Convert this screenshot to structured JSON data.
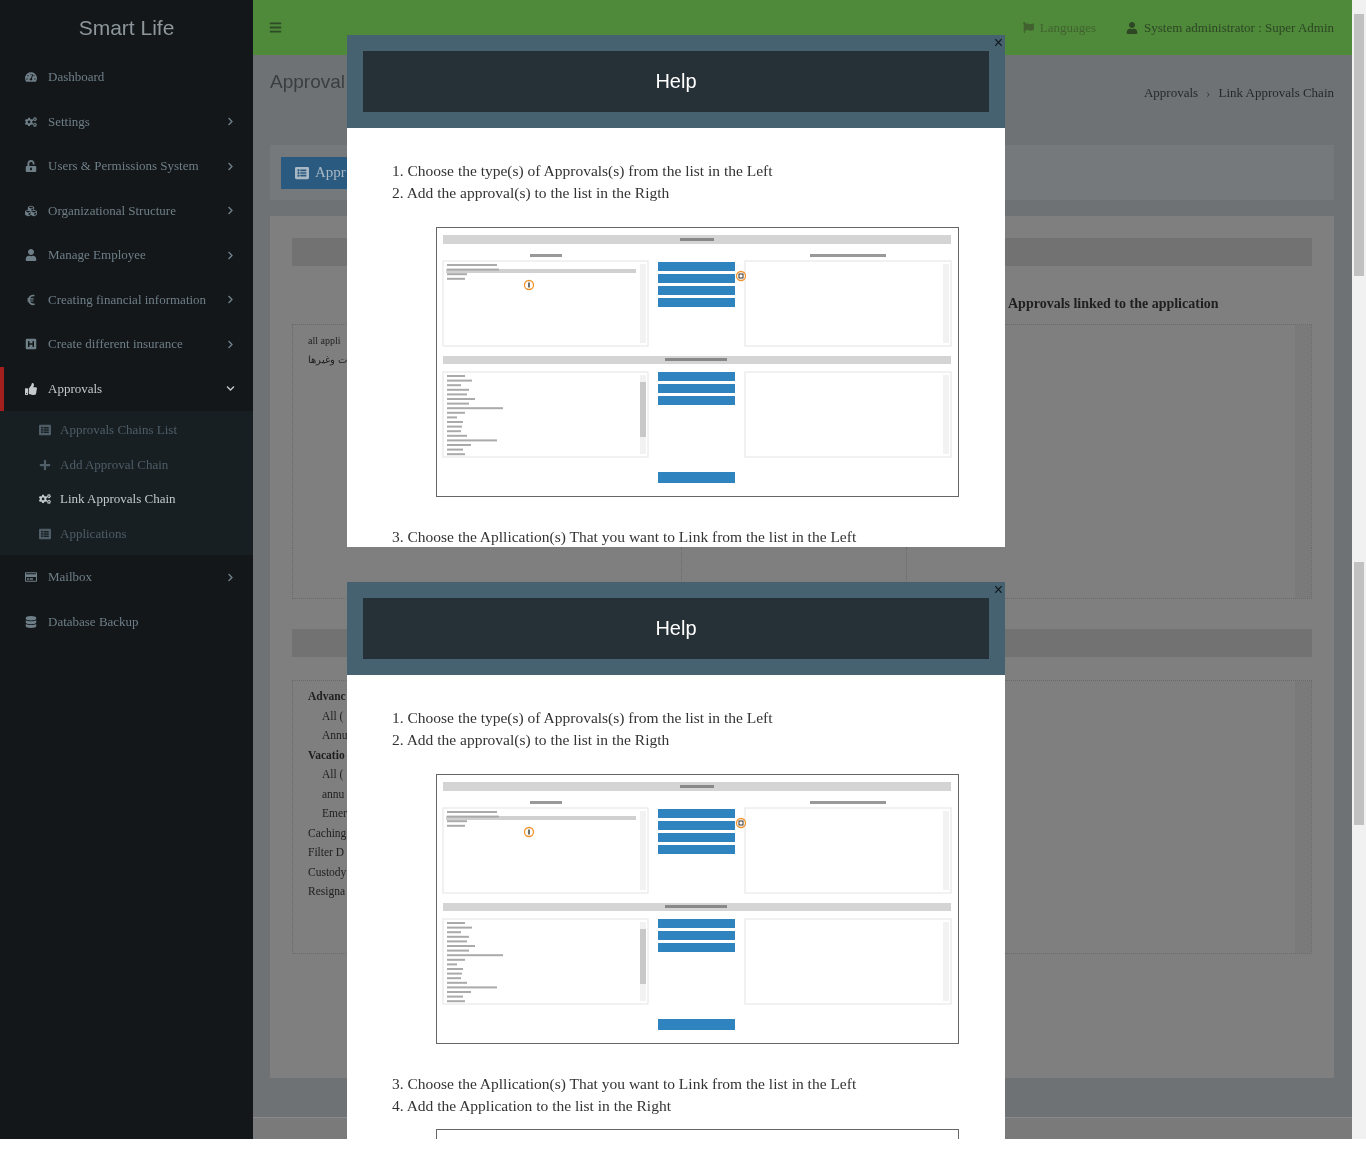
{
  "sidebar": {
    "brand": "Smart Life",
    "items": [
      {
        "label": "Dashboard",
        "kind": "link",
        "selected": false
      },
      {
        "label": "Settings",
        "kind": "menu",
        "expanded": false,
        "selected": false
      },
      {
        "label": "Users & Permissions System",
        "kind": "menu",
        "expanded": false,
        "selected": false
      },
      {
        "label": "Organizational Structure",
        "kind": "menu",
        "expanded": false,
        "selected": false
      },
      {
        "label": "Manage Employee",
        "kind": "menu",
        "expanded": false,
        "selected": false
      },
      {
        "label": "Creating financial information",
        "kind": "menu",
        "expanded": false,
        "selected": false
      },
      {
        "label": "Create different insurance",
        "kind": "menu",
        "expanded": false,
        "selected": false
      },
      {
        "label": "Approvals",
        "kind": "menu",
        "expanded": true,
        "selected": true,
        "children": [
          {
            "label": "Approvals Chains List",
            "selected": false
          },
          {
            "label": "Add Approval Chain",
            "selected": false
          },
          {
            "label": "Link Approvals Chain",
            "selected": true
          },
          {
            "label": "Applications",
            "selected": false
          }
        ]
      },
      {
        "label": "Mailbox",
        "kind": "menu",
        "expanded": false,
        "selected": false
      },
      {
        "label": "Database Backup",
        "kind": "link",
        "selected": false
      }
    ]
  },
  "top_screen": {
    "header": {
      "languages": "Languages",
      "user": "System administrator : Super Admin"
    },
    "page_title": "Approval",
    "breadcrumb": [
      {
        "label": "Approvals"
      },
      {
        "separator": "›",
        "label": "Link Approvals Chain"
      }
    ],
    "tab_button": "Appr",
    "linked_label": "Approvals linked to the application",
    "list_items": [
      "all appli",
      "ت وغيرها"
    ],
    "modal": {
      "title": "Help",
      "close": "×",
      "steps": [
        "1. Choose the type(s) of Approvals(s) from the list in the Left",
        "2. Add the approval(s) to the list in the Rigth"
      ],
      "figure": {
        "kind": "screenshot"
      },
      "steps_after": [
        "3. Choose the Apllication(s) That you want to Link from the list in the Left"
      ]
    }
  },
  "bottom_screen": {
    "list_items": [
      {
        "label": "Advanc",
        "kind": "group"
      },
      {
        "label": "All (",
        "kind": "option"
      },
      {
        "label": "Annu",
        "kind": "option"
      },
      {
        "label": "Vacatio",
        "kind": "group"
      },
      {
        "label": "All (",
        "kind": "option"
      },
      {
        "label": "annu",
        "kind": "option"
      },
      {
        "label": "Emer",
        "kind": "option"
      },
      {
        "label": "Caching",
        "kind": "item"
      },
      {
        "label": "Filter D",
        "kind": "item"
      },
      {
        "label": "Custody",
        "kind": "item"
      },
      {
        "label": "Resigna",
        "kind": "item"
      }
    ],
    "modal": {
      "title": "Help",
      "close": "×",
      "steps": [
        "1. Choose the type(s) of Approvals(s) from the list in the Left",
        "2. Add the approval(s) to the list in the Rigth"
      ],
      "figure": {
        "kind": "screenshot"
      },
      "steps_after": [
        "3. Choose the Apllication(s) That you want to Link from the list in the Left",
        "4. Add the Application to the list in the Right"
      ]
    }
  }
}
